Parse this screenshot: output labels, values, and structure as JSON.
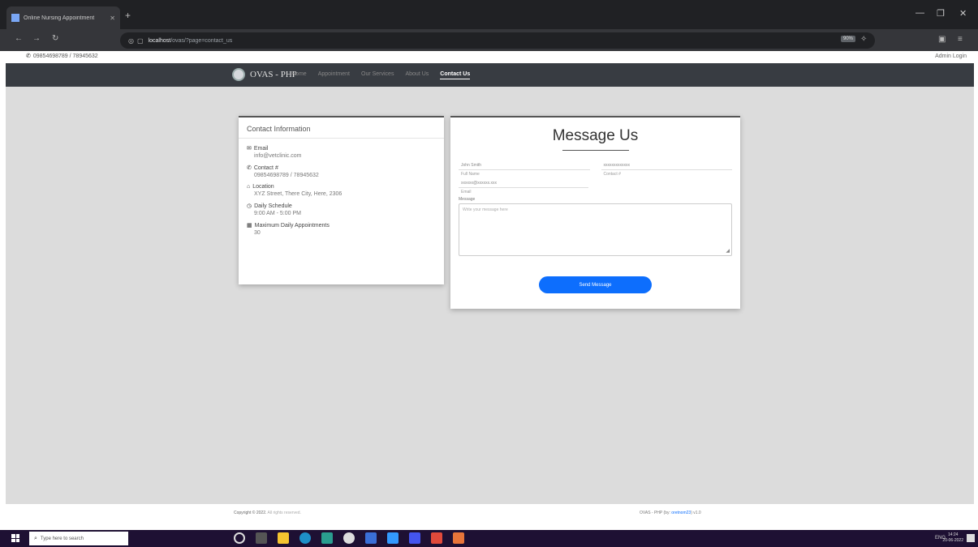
{
  "browser": {
    "tab_title": "Online Nursing Appointment",
    "url_host": "localhost",
    "url_path": "/ovas/?page=contact_us",
    "zoom": "90%"
  },
  "topbar": {
    "phone": "09854698789 / 78945632",
    "admin_login": "Admin Login"
  },
  "navbar": {
    "brand": "OVAS - PHP",
    "links": [
      "Home",
      "Appointment",
      "Our Services",
      "About Us",
      "Contact Us"
    ]
  },
  "contact": {
    "header": "Contact Information",
    "items": [
      {
        "label": "Email",
        "value": "info@vetclinic.com"
      },
      {
        "label": "Contact #",
        "value": "09854698789 / 78945632"
      },
      {
        "label": "Location",
        "value": "XYZ Street, There City, Here, 2306"
      },
      {
        "label": "Daily Schedule",
        "value": "9:00 AM - 5:00 PM"
      },
      {
        "label": "Maximum Daily Appointments",
        "value": "30"
      }
    ]
  },
  "message_form": {
    "title": "Message Us",
    "fullname_placeholder": "John Smith",
    "fullname_label": "Full Name",
    "contact_placeholder": "xxxxxxxxxxxxx",
    "contact_label": "Contact #",
    "email_placeholder": "xxxxxx@xxxxxx.xxx",
    "email_label": "Email",
    "message_label": "Message",
    "message_placeholder": "Write your message here",
    "submit_label": "Send Message"
  },
  "footer": {
    "copyright": "Copyright © 2022.",
    "rights": "All rights reserved.",
    "credit_prefix": "OVAS - PHP (by:",
    "credit_author": "oretnom23",
    "credit_suffix": ") v1.0"
  },
  "taskbar": {
    "search_placeholder": "Type here to search",
    "time": "14:24",
    "date": "20-06-2022",
    "tray": "ENG"
  }
}
